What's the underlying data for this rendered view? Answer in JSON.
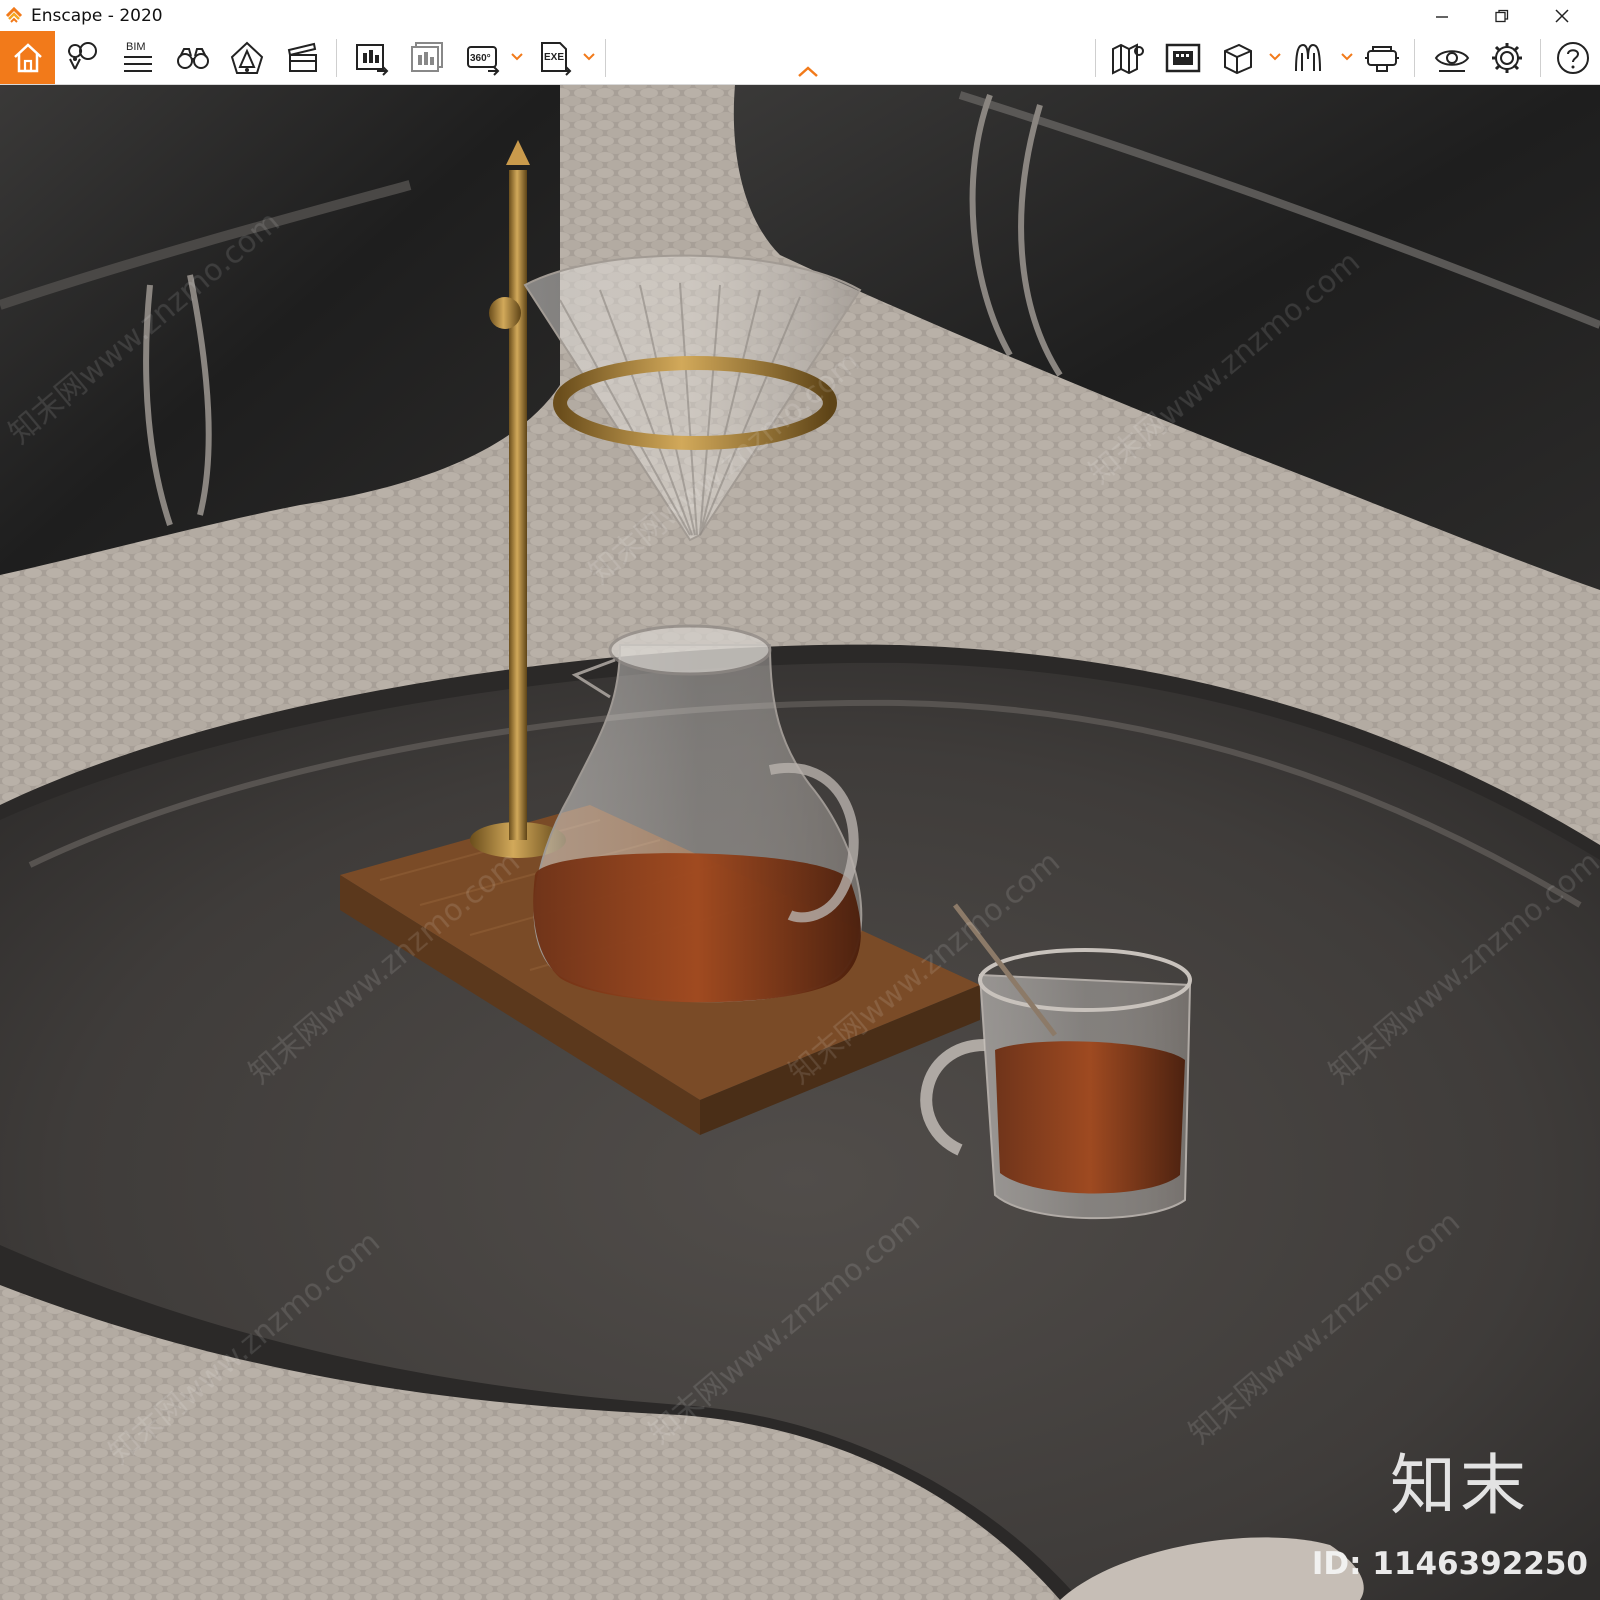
{
  "window": {
    "title": "Enscape - 2020",
    "controls": [
      "minimize",
      "restore",
      "close"
    ]
  },
  "toolbar": {
    "accent_color": "#f27a1a",
    "left_buttons": [
      {
        "name": "home-icon",
        "label": ""
      },
      {
        "name": "map-pin-bubble-icon",
        "label": ""
      },
      {
        "name": "bim-icon",
        "label": "BIM"
      },
      {
        "name": "binoculars-icon",
        "label": ""
      },
      {
        "name": "sun-pyramid-icon",
        "label": ""
      },
      {
        "name": "clapperboard-icon",
        "label": ""
      },
      {
        "name": "export-image-icon",
        "label": ""
      },
      {
        "name": "batch-export-icon",
        "label": ""
      },
      {
        "name": "export-360-icon",
        "label": "360°"
      },
      {
        "name": "export-exe-icon",
        "label": "EXE"
      }
    ],
    "right_buttons": [
      {
        "name": "map-icon"
      },
      {
        "name": "building-view-icon"
      },
      {
        "name": "cube-icon"
      },
      {
        "name": "collaborative-annotation-icon"
      },
      {
        "name": "vr-headset-icon"
      },
      {
        "name": "visual-settings-eye-icon"
      },
      {
        "name": "settings-gear-icon"
      },
      {
        "name": "help-icon"
      }
    ]
  },
  "watermark": {
    "brand": "知末",
    "asset_id": "ID: 1146392250",
    "repeating_text": "知末网www.znzmo.com"
  }
}
